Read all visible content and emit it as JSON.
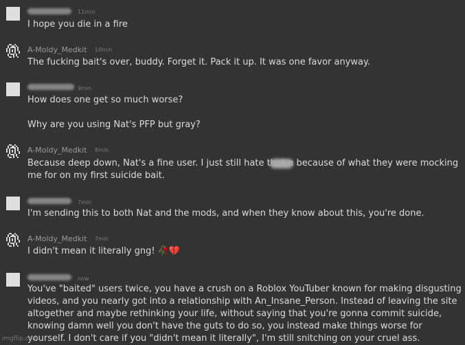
{
  "messages": [
    {
      "author": "",
      "redacted": true,
      "time": "11min",
      "text": "I hope you die in a fire",
      "avatar": "blank-avatar"
    },
    {
      "author": "A-Moldy_Medkit",
      "redacted": false,
      "time": "10min",
      "text": "The fucking bait's over, buddy. Forget it. Pack it up. It was one favor anyway.",
      "avatar": "pixel-avatar"
    },
    {
      "author": "",
      "redacted": true,
      "time": "9min",
      "text": "How does one get so much worse?\n\nWhy are you using Nat's PFP but gray?",
      "avatar": "blank-avatar"
    },
    {
      "author": "A-Moldy_Medkit",
      "redacted": false,
      "time": "8min",
      "text": "Because deep down, Nat's a fine user. I just still hate that n         because of what they were mocking me for on my first suicide bait.",
      "avatar": "pixel-avatar"
    },
    {
      "author": "",
      "redacted": true,
      "time": "7min",
      "text": "I'm sending this to both Nat and the mods, and when they know about this, you're done.",
      "avatar": "blank-avatar"
    },
    {
      "author": "A-Moldy_Medkit",
      "redacted": false,
      "time": "7min",
      "text": "I didn't mean it literally gng! 🥀💔",
      "avatar": "pixel-avatar"
    },
    {
      "author": "",
      "redacted": true,
      "time": "now",
      "text": "You've \"baited\" users twice, you have a crush on a Roblox YouTuber known for making disgusting videos, and you nearly got into a relationship with An_Insane_Person. Instead of leaving the site altogether and maybe rethinking your life, without saying that you're gonna commit suicide, knowing damn well you don't have the guts to do so, you instead make things worse for yourself. I don't care if you \"didn't mean it literally\", I'm still snitching on your cruel ass.",
      "avatar": "blank-avatar"
    }
  ],
  "watermark": "imgflip.com",
  "colors": {
    "background": "#333333",
    "text": "#dcdcdc",
    "meta": "#7b7b7b"
  }
}
